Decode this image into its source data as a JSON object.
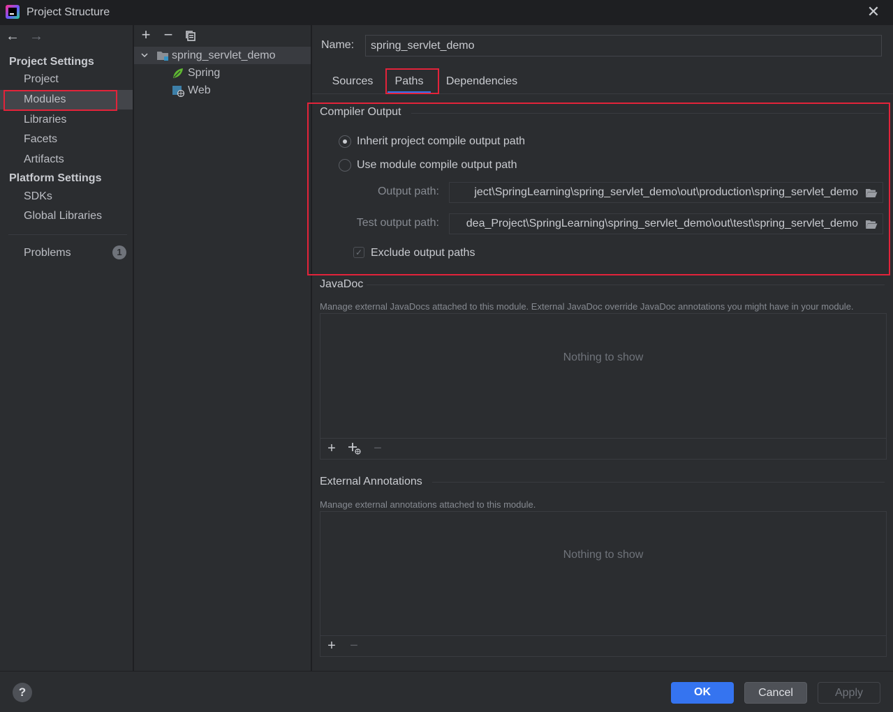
{
  "window": {
    "title": "Project Structure",
    "close_glyph": "✕"
  },
  "nav": {
    "back_glyph": "←",
    "forward_glyph": "→"
  },
  "sidebar": {
    "project_settings_header": "Project Settings",
    "project_items": [
      "Project",
      "Modules",
      "Libraries",
      "Facets",
      "Artifacts"
    ],
    "platform_settings_header": "Platform Settings",
    "platform_items": [
      "SDKs",
      "Global Libraries"
    ],
    "problems_label": "Problems",
    "problems_count": "1",
    "selected_item": "Modules"
  },
  "tree": {
    "toolbar": {
      "add_glyph": "+",
      "remove_glyph": "−"
    },
    "root": "spring_servlet_demo",
    "children": [
      "Spring",
      "Web"
    ]
  },
  "module": {
    "name_label": "Name:",
    "name_value": "spring_servlet_demo",
    "tabs": [
      "Sources",
      "Paths",
      "Dependencies"
    ],
    "active_tab": "Paths"
  },
  "compiler_output": {
    "title": "Compiler Output",
    "inherit_label": "Inherit project compile output path",
    "use_module_label": "Use module compile output path",
    "selected_option": "inherit",
    "output_path_label": "Output path:",
    "output_path_value": "ject\\SpringLearning\\spring_servlet_demo\\out\\production\\spring_servlet_demo",
    "test_output_path_label": "Test output path:",
    "test_output_path_value": "dea_Project\\SpringLearning\\spring_servlet_demo\\out\\test\\spring_servlet_demo",
    "exclude_label": "Exclude output paths",
    "exclude_checked": true,
    "check_glyph": "✓"
  },
  "javadoc": {
    "title": "JavaDoc",
    "description": "Manage external JavaDocs attached to this module. External JavaDoc override JavaDoc annotations you might have in your module.",
    "empty_text": "Nothing to show",
    "add_glyph": "+",
    "remove_glyph": "−"
  },
  "external_annotations": {
    "title": "External Annotations",
    "description": "Manage external annotations attached to this module.",
    "empty_text": "Nothing to show",
    "add_glyph": "+",
    "remove_glyph": "−"
  },
  "footer": {
    "help_glyph": "?",
    "ok_label": "OK",
    "cancel_label": "Cancel",
    "apply_label": "Apply"
  },
  "colors": {
    "accent": "#3574f0",
    "highlight_box": "#e3233a",
    "panel_bg": "#2b2d30"
  }
}
